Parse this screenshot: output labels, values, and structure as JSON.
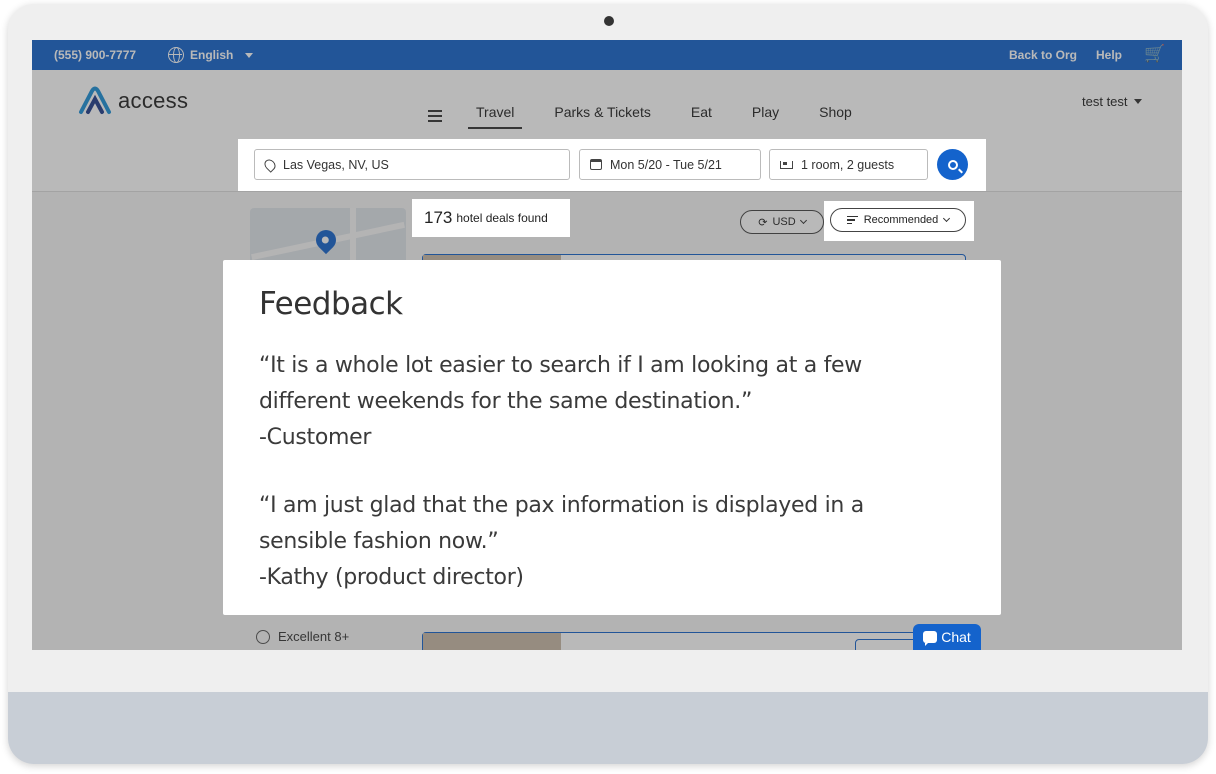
{
  "topbar": {
    "phone": "(555) 900-7777",
    "language": "English",
    "back_to_org": "Back to Org",
    "help": "Help",
    "cart_icon": "cart-icon"
  },
  "header": {
    "logo_text": "access",
    "nav": [
      "Travel",
      "Parks & Tickets",
      "Eat",
      "Play",
      "Shop"
    ],
    "active_nav": "Travel",
    "user": "test test"
  },
  "search": {
    "location": "Las Vegas, NV, US",
    "dates": "Mon 5/20 - Tue 5/21",
    "guests": "1 room, 2 guests"
  },
  "results": {
    "count": "173",
    "count_label": "hotel deals found",
    "currency": "USD",
    "sort": "Recommended",
    "filter_option": "Excellent 8+",
    "chat": "Chat"
  },
  "feedback": {
    "title": "Feedback",
    "quote1_line1": "“It is a whole lot easier to search if I am looking at a few",
    "quote1_line2": "different weekends for the same destination.”",
    "quote1_author": "-Customer",
    "quote2_line1": "“I am just glad that the pax information is displayed in a",
    "quote2_line2": "sensible fashion now.”",
    "quote2_author": "-Kathy (product director)"
  },
  "colors": {
    "brand_blue": "#1463cc",
    "frame": "#efefef",
    "chin": "#c8ced6"
  }
}
